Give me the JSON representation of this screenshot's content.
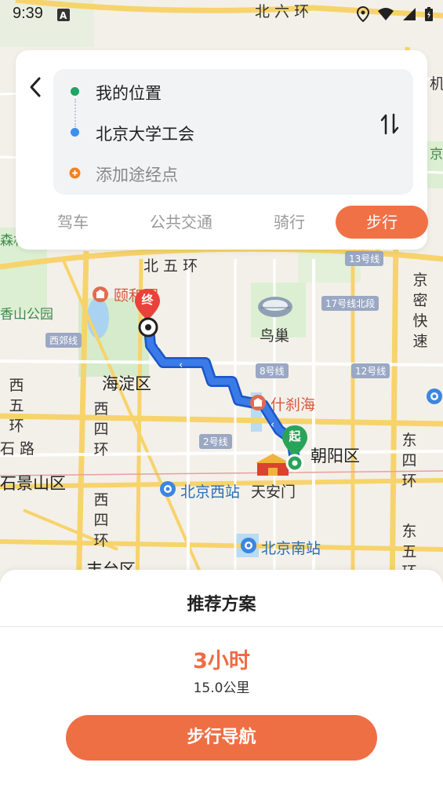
{
  "status_bar": {
    "time": "9:39"
  },
  "route": {
    "origin": "我的位置",
    "destination": "北京大学工会",
    "add_waypoint": "添加途经点"
  },
  "modes": [
    {
      "label": "驾车",
      "active": false
    },
    {
      "label": "公共交通",
      "active": false
    },
    {
      "label": "骑行",
      "active": false
    },
    {
      "label": "步行",
      "active": true
    }
  ],
  "map": {
    "start_marker": "起",
    "end_marker": "终",
    "labels": {
      "north_6th_ring": "北 六 环",
      "north_5th_ring": "北 五 环",
      "yiheyuan": "颐和园",
      "xiangshan_park": "香山公园",
      "niaochao": "鸟巢",
      "haidian": "海淀区",
      "shichahai": "什刹海",
      "chaoyang": "朝阳区",
      "beijing_west": "北京西站",
      "tiananmen": "天安门",
      "beijing_south": "北京南站",
      "shijingshan": "石景山区",
      "fengtai": "丰台区",
      "west_5th_ring": "西五环",
      "west_4th_ring_1": "西四环",
      "west_4th_ring_2": "西四环",
      "east_4th_ring": "东四环",
      "east_5th_ring": "东五环",
      "jingmi_expressway": "京密快速",
      "shilu": "石 路",
      "jichang": "机",
      "sensen": "森林",
      "jing": "京"
    },
    "badges": {
      "line13": "13号线",
      "line17": "17号线北段",
      "line8": "8号线",
      "line12": "12号线",
      "line2": "2号线",
      "xijiao": "西郊线"
    }
  },
  "sheet": {
    "title": "推荐方案",
    "duration": "3小时",
    "distance": "15.0公里",
    "nav_button": "步行导航"
  },
  "colors": {
    "accent": "#ef6f45",
    "route": "#3b7be8",
    "origin_dot": "#1fa366",
    "destination_dot": "#3d8ef0",
    "waypoint_dot": "#f5831f"
  }
}
